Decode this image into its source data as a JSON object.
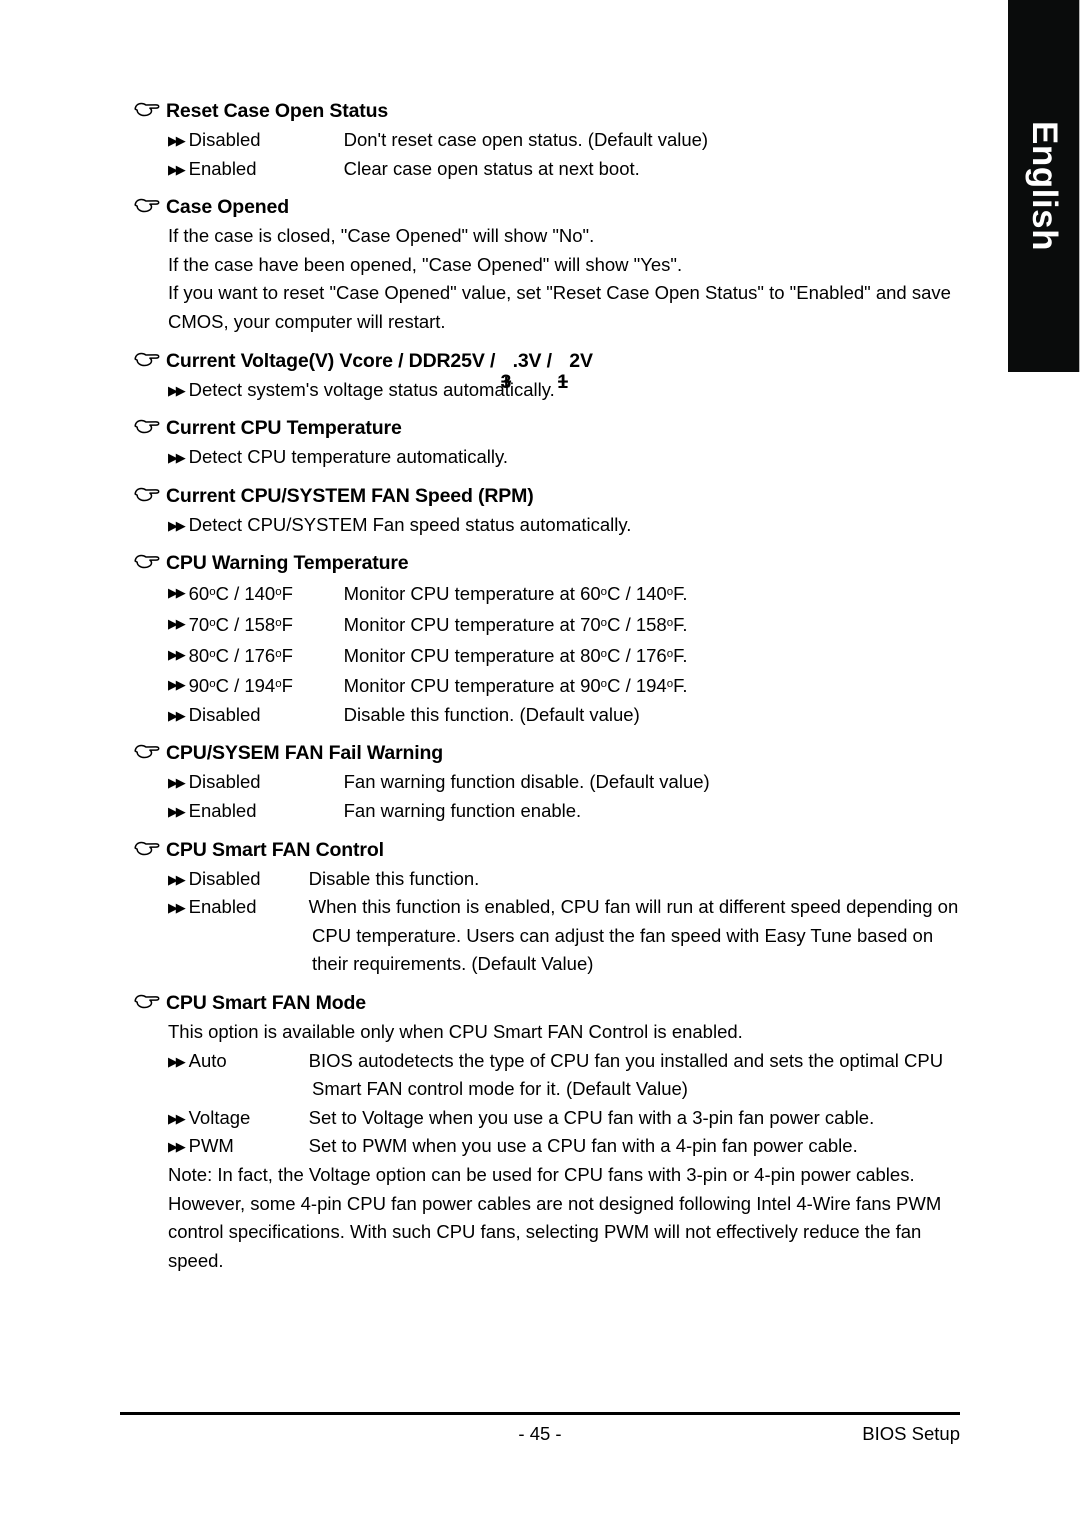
{
  "page": {
    "language_tab": "English",
    "page_number": "- 45 -",
    "footer_right": "BIOS Setup",
    "markers": {
      "section_icon": "pointing-hand-icon",
      "option_icon": "double-right-arrow-icon"
    }
  },
  "sections": [
    {
      "id": "reset-case-open-status",
      "heading": "Reset Case Open Status",
      "column": "wide",
      "options": [
        {
          "label": "Disabled",
          "desc": "Don't reset case open status. (Default value)"
        },
        {
          "label": "Enabled",
          "desc": "Clear case open status at next boot."
        }
      ],
      "paragraphs": [],
      "notes": []
    },
    {
      "id": "case-opened",
      "heading": "Case Opened",
      "column": "wide",
      "options": [],
      "paragraphs": [
        "If the case is closed, \"Case Opened\" will show \"No\".",
        "If the case have been opened, \"Case Opened\" will show \"Yes\".",
        "If you want to reset \"Case Opened\" value, set \"Reset Case Open Status\" to \"Enabled\" and save",
        "CMOS, your computer will restart."
      ],
      "notes": []
    },
    {
      "id": "current-voltage",
      "heading_parts": {
        "before": "Current Voltage(V) Vcore / DDR25V / ",
        "overlap_1_base": "3",
        "overlap_1_over": "+",
        "middle": ".3V / ",
        "overlap_2_base": "1",
        "overlap_2_over": "+",
        "after": "2V"
      },
      "heading": "Current Voltage(V) Vcore / DDR25V / +3.3V / +12V",
      "column": "wide",
      "options": [
        {
          "label": "",
          "desc": "Detect system's voltage status automatically."
        }
      ],
      "paragraphs": [],
      "notes": []
    },
    {
      "id": "current-cpu-temperature",
      "heading": "Current CPU Temperature",
      "column": "wide",
      "options": [
        {
          "label": "",
          "desc": "Detect CPU temperature automatically."
        }
      ],
      "paragraphs": [],
      "notes": []
    },
    {
      "id": "current-cpu-system-fan-speed",
      "heading": "Current CPU/SYSTEM FAN Speed (RPM)",
      "column": "wide",
      "options": [
        {
          "label": "",
          "desc": "Detect CPU/SYSTEM Fan speed status automatically."
        }
      ],
      "paragraphs": [],
      "notes": []
    },
    {
      "id": "cpu-warning-temperature",
      "heading": "CPU Warning Temperature",
      "column": "wide",
      "temperature_options": [
        {
          "celsius": "60",
          "fahrenheit": "140"
        },
        {
          "celsius": "70",
          "fahrenheit": "158"
        },
        {
          "celsius": "80",
          "fahrenheit": "176"
        },
        {
          "celsius": "90",
          "fahrenheit": "194"
        }
      ],
      "options": [
        {
          "label": "Disabled",
          "desc": "Disable this function. (Default value)"
        }
      ],
      "paragraphs": [],
      "notes": []
    },
    {
      "id": "cpu-sysem-fan-fail-warning",
      "heading": "CPU/SYSEM FAN Fail Warning",
      "column": "wide",
      "options": [
        {
          "label": "Disabled",
          "desc": "Fan warning function disable. (Default value)"
        },
        {
          "label": "Enabled",
          "desc": "Fan warning function enable."
        }
      ],
      "paragraphs": [],
      "notes": []
    },
    {
      "id": "cpu-smart-fan-control",
      "heading": "CPU Smart FAN Control",
      "column": "narrow",
      "options": [
        {
          "label": "Disabled",
          "desc": "Disable this function."
        },
        {
          "label": "Enabled",
          "desc": "When this function is enabled, CPU fan will run at different speed depending on",
          "cont": [
            "CPU temperature. Users can adjust the fan speed with Easy Tune based on",
            "their requirements. (Default Value)"
          ]
        }
      ],
      "paragraphs": [],
      "notes": []
    },
    {
      "id": "cpu-smart-fan-mode",
      "heading": "CPU Smart FAN Mode",
      "column": "narrow",
      "paragraphs": [
        "This option is available only when CPU Smart FAN Control is enabled."
      ],
      "options": [
        {
          "label": "Auto",
          "desc": "BIOS autodetects the type of CPU fan you installed and sets the optimal CPU",
          "cont": [
            "Smart FAN control mode for it. (Default Value)"
          ]
        },
        {
          "label": "Voltage",
          "desc": "Set to Voltage when you use a CPU fan with a 3-pin fan power cable."
        },
        {
          "label": "PWM",
          "desc": "Set to PWM when you use a CPU fan with a 4-pin fan power cable."
        }
      ],
      "notes": [
        "Note: In fact, the Voltage option can be used for CPU fans with 3-pin or 4-pin power cables.",
        "However, some 4-pin CPU fan power cables are not designed following Intel 4-Wire fans PWM",
        "control specifications. With such CPU fans, selecting PWM will not effectively reduce the fan",
        "speed."
      ]
    }
  ]
}
